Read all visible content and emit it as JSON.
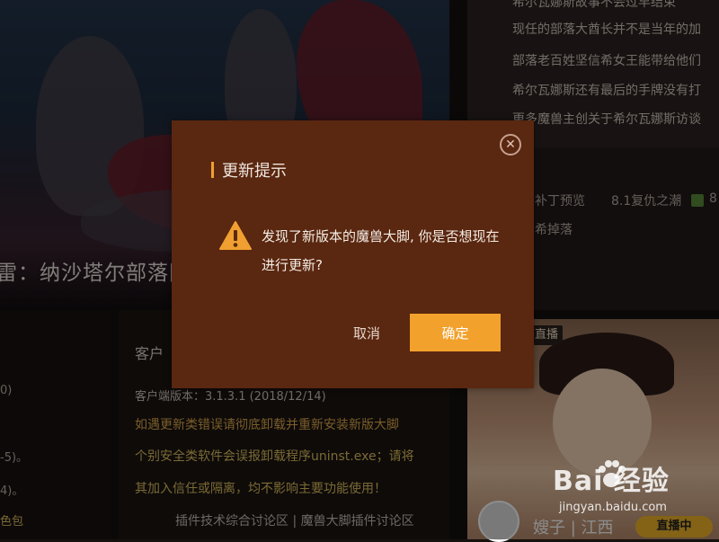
{
  "banner": {
    "title": "雷：纳沙塔尔部落阵"
  },
  "news": {
    "items": [
      "希尔瓦娜斯故事不会过早结束",
      "现任的部落大酋长并不是当年的加",
      "部落老百姓坚信希女王能带给他们",
      "希尔瓦娜斯还有最后的手牌没有打",
      "更多魔兽主创关于希尔瓦娜斯访谈"
    ]
  },
  "tags": {
    "row1": [
      "补丁预览",
      "8.1复仇之潮",
      "8"
    ],
    "row2": "希掉落"
  },
  "left_col": {
    "lines": [
      "0)",
      "-5)。",
      "4)。",
      "色包"
    ]
  },
  "client": {
    "title": "客户",
    "version": "客户端版本：3.1.3.1 (2018/12/14)",
    "notice1": "如遇更新类错误请彻底卸载并重新安装新版大脚",
    "notice2": "个别安全类软件会误报卸载程序uninst.exe；请将",
    "notice3": "其加入信任或隔离，均不影响主要功能使用！",
    "links": "插件技术综合讨论区 | 魔兽大脚插件讨论区"
  },
  "live": {
    "badge": "直播",
    "streamer": "嫂子 | 江西",
    "onair": "直播中"
  },
  "watermark": {
    "brand": "Bai  经验",
    "url": "jingyan.baidu.com"
  },
  "dialog": {
    "title": "更新提示",
    "message_line1": "发现了新版本的魔兽大脚, 你是否想现在",
    "message_line2": "进行更新?",
    "cancel_label": "取消",
    "ok_label": "确定",
    "close_symbol": "✕"
  },
  "colors": {
    "dialog_bg": "#5a2710",
    "accent": "#f2a12c",
    "warning": "#f0a030"
  }
}
